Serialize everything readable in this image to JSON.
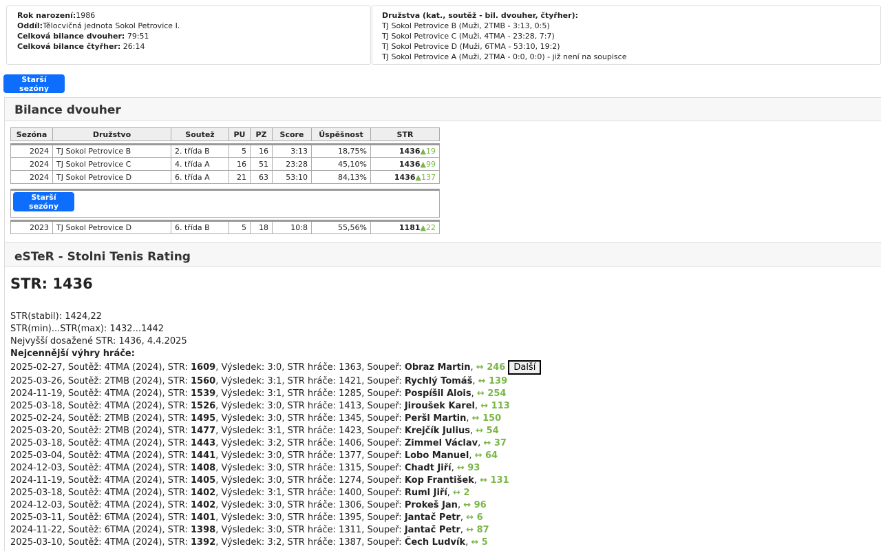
{
  "info": {
    "birth_label": "Rok narození:",
    "birth": "1986",
    "club_label": "Oddíl:",
    "club": "Tělocvičná jednota Sokol Petrovice I.",
    "singles_label": "Celková bilance dvouher:",
    "singles": "79:51",
    "doubles_label": "Celková bilance čtyřher:",
    "doubles": "26:14"
  },
  "teams": {
    "title": "Družstva (kat., soutěž - bil. dvouher, čtyřher):",
    "items": [
      "TJ Sokol Petrovice B (Muži, 2TMB - 3:13, 0:5)",
      "TJ Sokol Petrovice C (Muži, 4TMA - 23:28, 7:7)",
      "TJ Sokol Petrovice D (Muži, 6TMA - 53:10, 19:2)",
      "TJ Sokol Petrovice A (Muži, 2TMA - 0:0, 0:0) - již není na soupisce"
    ]
  },
  "older_seasons_label": "Starší sezóny",
  "balance": {
    "title": "Bilance dvouher",
    "headers": [
      "Sezóna",
      "Družstvo",
      "Soutež",
      "PU",
      "PZ",
      "Score",
      "Úspěšnost",
      "STR"
    ],
    "rows": [
      {
        "season": "2024",
        "team": "TJ Sokol Petrovice B",
        "comp": "2. třída B",
        "pu": "5",
        "pz": "16",
        "score": "3:13",
        "pct": "18,75%",
        "str": "1436",
        "delta": "▲19"
      },
      {
        "season": "2024",
        "team": "TJ Sokol Petrovice C",
        "comp": "4. třída A",
        "pu": "16",
        "pz": "51",
        "score": "23:28",
        "pct": "45,10%",
        "str": "1436",
        "delta": "▲99"
      },
      {
        "season": "2024",
        "team": "TJ Sokol Petrovice D",
        "comp": "6. třída A",
        "pu": "21",
        "pz": "63",
        "score": "53:10",
        "pct": "84,13%",
        "str": "1436",
        "delta": "▲137"
      }
    ],
    "older_rows": [
      {
        "season": "2023",
        "team": "TJ Sokol Petrovice D",
        "comp": "6. třída B",
        "pu": "5",
        "pz": "18",
        "score": "10:8",
        "pct": "55,56%",
        "str": "1181",
        "delta": "▲22"
      }
    ]
  },
  "ester": {
    "title": "eSTeR - Stolni Tenis Rating",
    "str_main": "STR: 1436",
    "stabil": "STR(stabil): 1424,22",
    "minmax": "STR(min)...STR(max): 1432...1442",
    "max_reached": "Nejvyšší dosažené STR: 1436, 4.4.2025",
    "wins_title": "Nejcennější výhry hráče:",
    "more_label": "Další",
    "wins": [
      {
        "date": "2025-02-27",
        "comp": "4TMA (2024)",
        "str": "1609",
        "res": "3:0",
        "pstr": "1363",
        "opp": "Obraz Martin",
        "delta": "↔ 246"
      },
      {
        "date": "2025-03-26",
        "comp": "2TMB (2024)",
        "str": "1560",
        "res": "3:1",
        "pstr": "1421",
        "opp": "Rychlý Tomáš",
        "delta": "↔ 139"
      },
      {
        "date": "2024-11-19",
        "comp": "4TMA (2024)",
        "str": "1539",
        "res": "3:1",
        "pstr": "1285",
        "opp": "Pospíšil Alois",
        "delta": "↔ 254"
      },
      {
        "date": "2025-03-18",
        "comp": "4TMA (2024)",
        "str": "1526",
        "res": "3:0",
        "pstr": "1413",
        "opp": "Jiroušek Karel",
        "delta": "↔ 113"
      },
      {
        "date": "2025-02-24",
        "comp": "2TMB (2024)",
        "str": "1495",
        "res": "3:0",
        "pstr": "1345",
        "opp": "Peršl Martin",
        "delta": "↔ 150"
      },
      {
        "date": "2025-03-20",
        "comp": "2TMB (2024)",
        "str": "1477",
        "res": "3:1",
        "pstr": "1423",
        "opp": "Krejčík Julius",
        "delta": "↔ 54"
      },
      {
        "date": "2025-03-18",
        "comp": "4TMA (2024)",
        "str": "1443",
        "res": "3:2",
        "pstr": "1406",
        "opp": "Zimmel Václav",
        "delta": "↔ 37"
      },
      {
        "date": "2025-03-04",
        "comp": "4TMA (2024)",
        "str": "1441",
        "res": "3:0",
        "pstr": "1377",
        "opp": "Lobo Manuel",
        "delta": "↔ 64"
      },
      {
        "date": "2024-12-03",
        "comp": "4TMA (2024)",
        "str": "1408",
        "res": "3:0",
        "pstr": "1315",
        "opp": "Chadt Jiří",
        "delta": "↔ 93"
      },
      {
        "date": "2024-11-19",
        "comp": "4TMA (2024)",
        "str": "1405",
        "res": "3:0",
        "pstr": "1274",
        "opp": "Kop František",
        "delta": "↔ 131"
      },
      {
        "date": "2025-03-18",
        "comp": "4TMA (2024)",
        "str": "1402",
        "res": "3:1",
        "pstr": "1400",
        "opp": "Ruml Jiří",
        "delta": "↔ 2"
      },
      {
        "date": "2024-12-03",
        "comp": "4TMA (2024)",
        "str": "1402",
        "res": "3:0",
        "pstr": "1306",
        "opp": "Prokeš Jan",
        "delta": "↔ 96"
      },
      {
        "date": "2025-03-11",
        "comp": "6TMA (2024)",
        "str": "1401",
        "res": "3:0",
        "pstr": "1395",
        "opp": "Jantač Petr",
        "delta": "↔ 6"
      },
      {
        "date": "2024-11-22",
        "comp": "6TMA (2024)",
        "str": "1398",
        "res": "3:0",
        "pstr": "1311",
        "opp": "Jantač Petr",
        "delta": "↔ 87"
      },
      {
        "date": "2025-03-10",
        "comp": "4TMA (2024)",
        "str": "1392",
        "res": "3:2",
        "pstr": "1387",
        "opp": "Čech Ludvík",
        "delta": "↔ 5"
      }
    ]
  }
}
